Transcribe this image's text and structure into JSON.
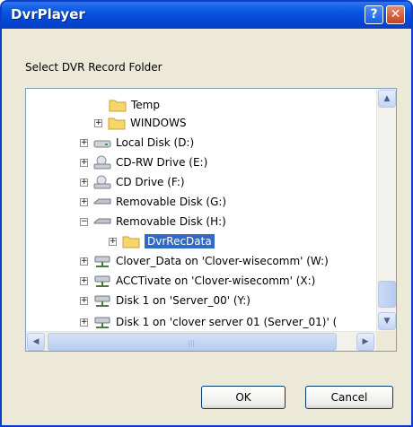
{
  "window": {
    "title": "DvrPlayer",
    "help_label": "?",
    "close_label": "✕"
  },
  "dialog": {
    "prompt": "Select DVR Record Folder"
  },
  "tree": {
    "items": [
      {
        "label": "Temp",
        "icon": "folder-icon",
        "expander": ""
      },
      {
        "label": "WINDOWS",
        "icon": "folder-icon",
        "expander": "+"
      },
      {
        "label": "Local Disk (D:)",
        "icon": "hard-drive-icon",
        "expander": "+"
      },
      {
        "label": "CD-RW Drive (E:)",
        "icon": "cd-drive-icon",
        "expander": "+"
      },
      {
        "label": "CD Drive (F:)",
        "icon": "cd-drive-icon",
        "expander": "+"
      },
      {
        "label": "Removable Disk (G:)",
        "icon": "removable-disk-icon",
        "expander": "+"
      },
      {
        "label": "Removable Disk (H:)",
        "icon": "removable-disk-icon",
        "expander": "−"
      },
      {
        "label": "DvrRecData",
        "icon": "folder-icon",
        "expander": "+",
        "selected": true
      },
      {
        "label": "Clover_Data on 'Clover-wisecomm' (W:)",
        "icon": "network-drive-icon",
        "expander": "+"
      },
      {
        "label": "ACCTivate on 'Clover-wisecomm' (X:)",
        "icon": "network-drive-icon",
        "expander": "+"
      },
      {
        "label": "Disk 1 on 'Server_00'  (Y:)",
        "icon": "network-drive-icon",
        "expander": "+"
      },
      {
        "label": "Disk 1 on 'clover server 01 (Server_01)' (",
        "icon": "network-drive-icon",
        "expander": "+"
      }
    ]
  },
  "scrollbar": {
    "up": "▲",
    "down": "▼",
    "left": "◀",
    "right": "▶",
    "grip": "|||"
  },
  "buttons": {
    "ok": "OK",
    "cancel": "Cancel"
  },
  "colors": {
    "titlebar": "#0a57e0",
    "selection": "#316ac5",
    "dialog_bg": "#ece9d8"
  }
}
